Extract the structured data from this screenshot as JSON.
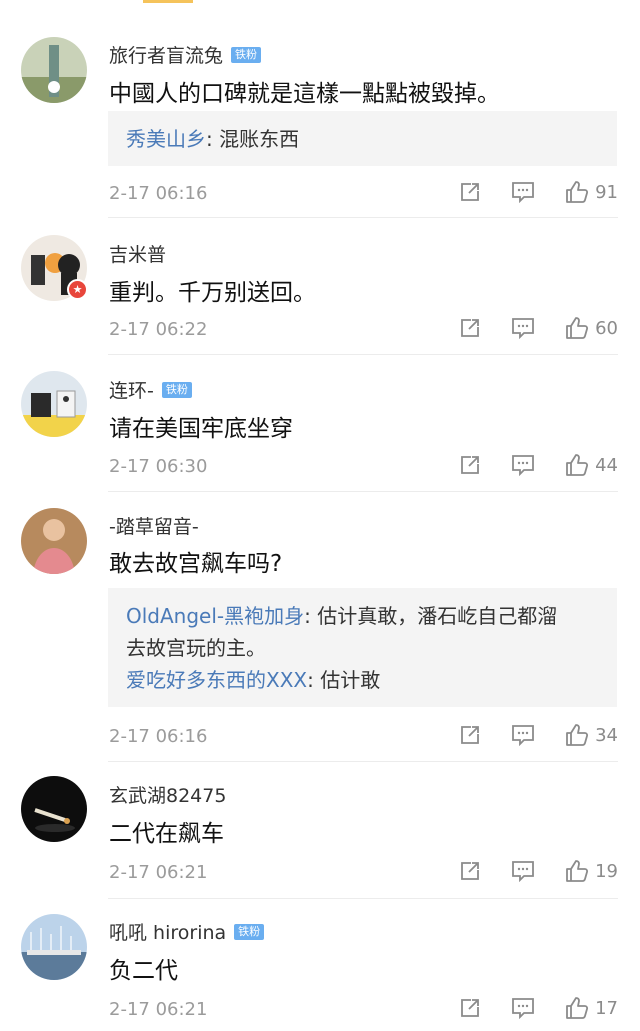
{
  "fan_badge": "铁粉",
  "comments": [
    {
      "user": "旅行者盲流兔",
      "badge": true,
      "text": "中國人的口碑就是這樣一點點被毀掉。",
      "replies": [
        {
          "user": "秀美山乡",
          "text": ": 混账东西"
        }
      ],
      "time": "2-17 06:16",
      "likes": "91"
    },
    {
      "user": "吉米普",
      "badge": false,
      "text": "重判。千万别送回。",
      "replies": [],
      "time": "2-17 06:22",
      "likes": "60"
    },
    {
      "user": "连环-",
      "badge": true,
      "text": "请在美国牢底坐穿",
      "replies": [],
      "time": "2-17 06:30",
      "likes": "44"
    },
    {
      "user": "-踏草留音-",
      "badge": false,
      "text": "敢去故宫飙车吗?",
      "replies": [
        {
          "user": "OldAngel-黑袍加身",
          "text": ": 估计真敢，潘石屹自己都溜",
          "cont": "去故宫玩的主。"
        },
        {
          "user": "爱吃好多东西的XXX",
          "text": ": 估计敢"
        }
      ],
      "time": "2-17 06:16",
      "likes": "34"
    },
    {
      "user": "玄武湖82475",
      "badge": false,
      "text": "二代在飙车",
      "replies": [],
      "time": "2-17 06:21",
      "likes": "19"
    },
    {
      "user": "吼吼 hirorina",
      "badge": true,
      "text": "负二代",
      "replies": [],
      "time": "2-17 06:21",
      "likes": "17"
    }
  ],
  "icons": {
    "share": "share-icon",
    "reply": "comment-icon",
    "like": "thumbs-up-icon"
  },
  "colors": {
    "reply_username": "#4a7ab8",
    "fan_badge": "#6aaef0",
    "accent_strip": "#f5c35b"
  }
}
